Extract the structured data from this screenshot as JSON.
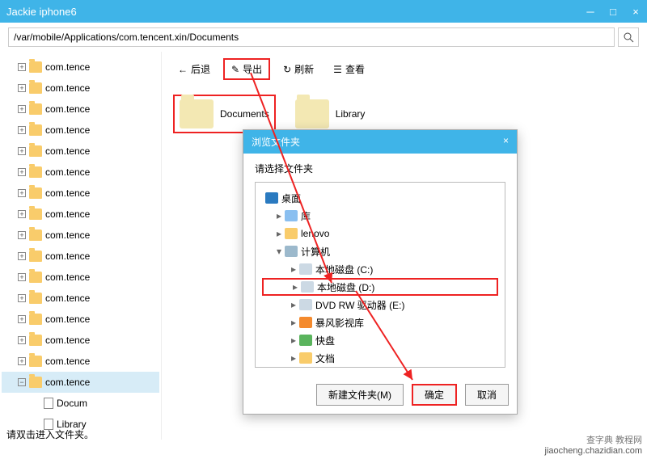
{
  "window": {
    "title": "Jackie iphone6"
  },
  "address": {
    "path": "/var/mobile/Applications/com.tencent.xin/Documents"
  },
  "toolbar": {
    "back": "后退",
    "export": "导出",
    "refresh": "刷新",
    "view": "查看"
  },
  "tree": {
    "items": [
      "com.tence",
      "com.tence",
      "com.tence",
      "com.tence",
      "com.tence",
      "com.tence",
      "com.tence",
      "com.tence",
      "com.tence",
      "com.tence",
      "com.tence",
      "com.tence",
      "com.tence",
      "com.tence",
      "com.tence",
      "com.tence"
    ],
    "sel_children": [
      "Docum",
      "Library"
    ]
  },
  "folders": {
    "a": "Documents",
    "b": "Library"
  },
  "modal": {
    "title": "浏览文件夹",
    "prompt": "请选择文件夹",
    "nodes": {
      "desktop": "桌面",
      "libs": "库",
      "lenovo": "lenovo",
      "computer": "计算机",
      "cdrive": "本地磁盘 (C:)",
      "ddrive": "本地磁盘 (D:)",
      "dvd": "DVD RW 驱动器 (E:)",
      "baofeng": "暴风影视库",
      "kuaipan": "快盘",
      "docs": "文档"
    },
    "newfolder": "新建文件夹(M)",
    "ok": "确定",
    "cancel": "取消"
  },
  "status": "请双击进入文件夹。",
  "watermark1": "查字典",
  "watermark2": "教程网",
  "watermark3": "jiaocheng.chazidian.com"
}
